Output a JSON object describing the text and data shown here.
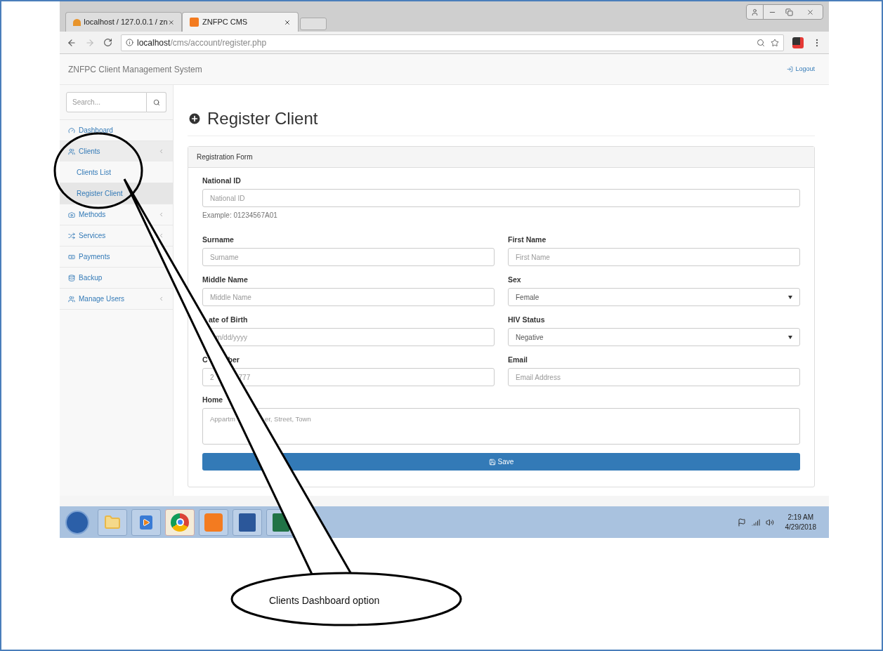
{
  "browser": {
    "tabs": [
      {
        "title": "localhost / 127.0.0.1 / zn",
        "selected": false
      },
      {
        "title": "ZNFPC CMS",
        "selected": true
      }
    ],
    "url_host": "localhost",
    "url_path": "/cms/account/register.php"
  },
  "navbar": {
    "brand": "ZNFPC Client Management System",
    "logout": "Logout"
  },
  "sidebar": {
    "search_placeholder": "Search...",
    "items": [
      {
        "label": "Dashboard",
        "has_children": false
      },
      {
        "label": "Clients",
        "has_children": true,
        "expanded": true,
        "children": [
          {
            "label": "Clients List",
            "selected": false
          },
          {
            "label": "Register Client",
            "selected": true
          }
        ]
      },
      {
        "label": "Methods",
        "has_children": true,
        "expanded": false
      },
      {
        "label": "Services",
        "has_children": true,
        "expanded": false
      },
      {
        "label": "Payments",
        "has_children": false
      },
      {
        "label": "Backup",
        "has_children": false
      },
      {
        "label": "Manage Users",
        "has_children": true,
        "expanded": false
      }
    ]
  },
  "page": {
    "title": "Register Client",
    "form_title": "Registration Form",
    "national_id": {
      "label": "National ID",
      "placeholder": "National ID",
      "help": "Example: 01234567A01"
    },
    "rows": [
      [
        {
          "label": [
            "Surname"
          ],
          "kind": "text",
          "placeholder": [
            "Surname"
          ]
        },
        {
          "label": [
            "First Name"
          ],
          "kind": "text",
          "placeholder": [
            "First Name"
          ]
        }
      ],
      [
        {
          "label": [
            "Middle Name"
          ],
          "kind": "text",
          "placeholder": [
            "Middle Name"
          ]
        },
        {
          "label": [
            "Sex"
          ],
          "kind": "select",
          "value": "Female"
        }
      ],
      [
        {
          "label": [
            "ate of Birth"
          ],
          "kind": "text",
          "placeholder": [
            "m/dd/yyyy"
          ]
        },
        {
          "label": [
            "HIV Status"
          ],
          "kind": "select",
          "value": "Negative"
        }
      ],
      [
        {
          "label": [
            "C",
            "ber"
          ],
          "kind": "text",
          "placeholder": [
            "2",
            "777"
          ]
        },
        {
          "label": [
            "Email"
          ],
          "kind": "text",
          "placeholder": [
            "Email Address"
          ]
        }
      ]
    ],
    "address": {
      "label": [
        "Home"
      ],
      "placeholder": [
        "Appartm",
        "er, Street, Town"
      ]
    },
    "save": "Save"
  },
  "taskbar": {
    "apps": [
      {
        "active": false
      },
      {
        "active": false
      },
      {
        "active": true
      },
      {
        "active": false
      },
      {
        "active": false
      },
      {
        "active": false
      }
    ],
    "time": "2:19 AM",
    "date": "4/29/2018"
  },
  "callout": {
    "text": "Clients Dashboard option"
  }
}
